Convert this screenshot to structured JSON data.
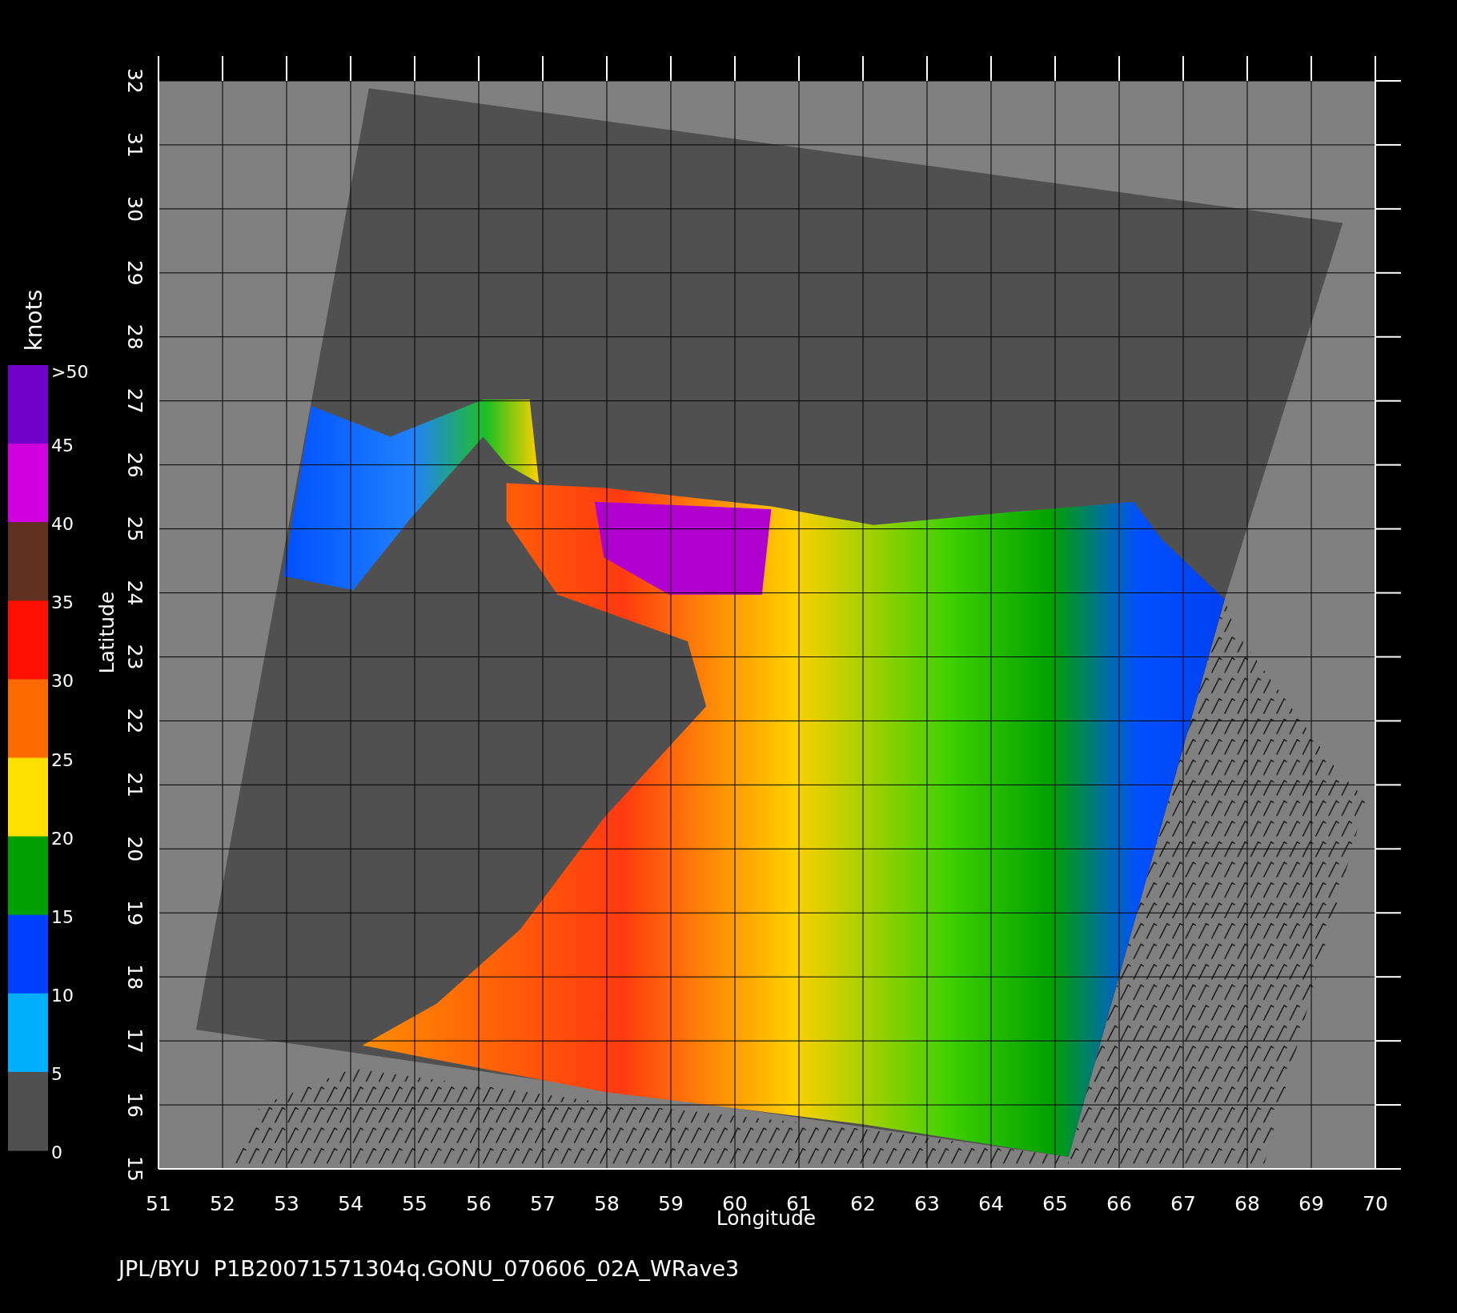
{
  "plot": {
    "x_axis": {
      "label": "Longitude",
      "ticks": [
        "51",
        "52",
        "53",
        "54",
        "55",
        "56",
        "57",
        "58",
        "59",
        "60",
        "61",
        "62",
        "63",
        "64",
        "65",
        "66",
        "67",
        "68",
        "69",
        "70"
      ]
    },
    "y_axis": {
      "label": "Latitude",
      "ticks": [
        "15",
        "16",
        "17",
        "18",
        "19",
        "20",
        "21",
        "22",
        "23",
        "24",
        "25",
        "26",
        "27",
        "28",
        "29",
        "30",
        "31",
        "32"
      ]
    }
  },
  "colorbar": {
    "unit": "knots",
    "labels": [
      ">50",
      "45",
      "40",
      "35",
      "30",
      "25",
      "20",
      "15",
      "10",
      "5",
      "0"
    ],
    "segments": [
      {
        "color": "#7000c8"
      },
      {
        "color": "#d000e0"
      },
      {
        "color": "#603020"
      },
      {
        "color": "#ff1000"
      },
      {
        "color": "#ff6a00"
      },
      {
        "color": "#ffe000"
      },
      {
        "color": "#00a000"
      },
      {
        "color": "#0040ff"
      },
      {
        "color": "#00b0ff"
      },
      {
        "color": "#505050"
      }
    ]
  },
  "caption": "JPL/BYU  P1B20071571304q.GONU_070606_02A_WRave3"
}
